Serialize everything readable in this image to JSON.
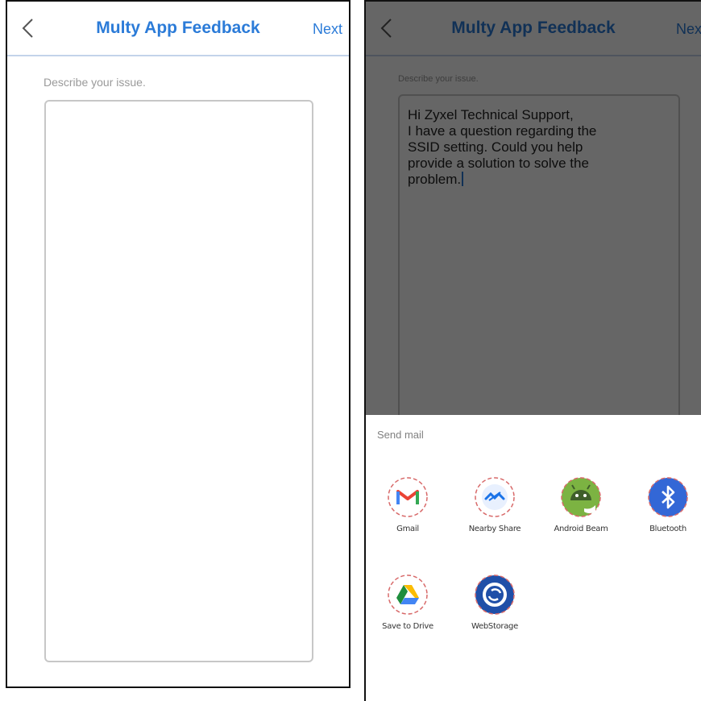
{
  "left_screen": {
    "header": {
      "title": "Multy App Feedback",
      "next_label": "Next"
    },
    "issue_label": "Describe your issue.",
    "issue_text": ""
  },
  "right_screen": {
    "header": {
      "title": "Multy App Feedback",
      "next_label": "Next"
    },
    "issue_label": "Describe your issue.",
    "issue_text_lines": [
      "Hi Zyxel Technical Support,",
      "I have a question regarding the",
      "SSID setting. Could you help",
      "provide a solution to solve the",
      "problem."
    ],
    "share_sheet": {
      "title": "Send mail",
      "apps": [
        {
          "label": "Gmail",
          "icon": "gmail-icon"
        },
        {
          "label": "Nearby Share",
          "icon": "nearby-share-icon"
        },
        {
          "label": "Android Beam",
          "icon": "android-beam-icon"
        },
        {
          "label": "Bluetooth",
          "icon": "bluetooth-icon"
        },
        {
          "label": "Save to Drive",
          "icon": "google-drive-icon"
        },
        {
          "label": "WebStorage",
          "icon": "webstorage-icon"
        }
      ]
    }
  },
  "colors": {
    "accent": "#2b7bd8",
    "header_border": "#c3d3ea",
    "scrim": "rgba(0,0,0,0.6)"
  }
}
